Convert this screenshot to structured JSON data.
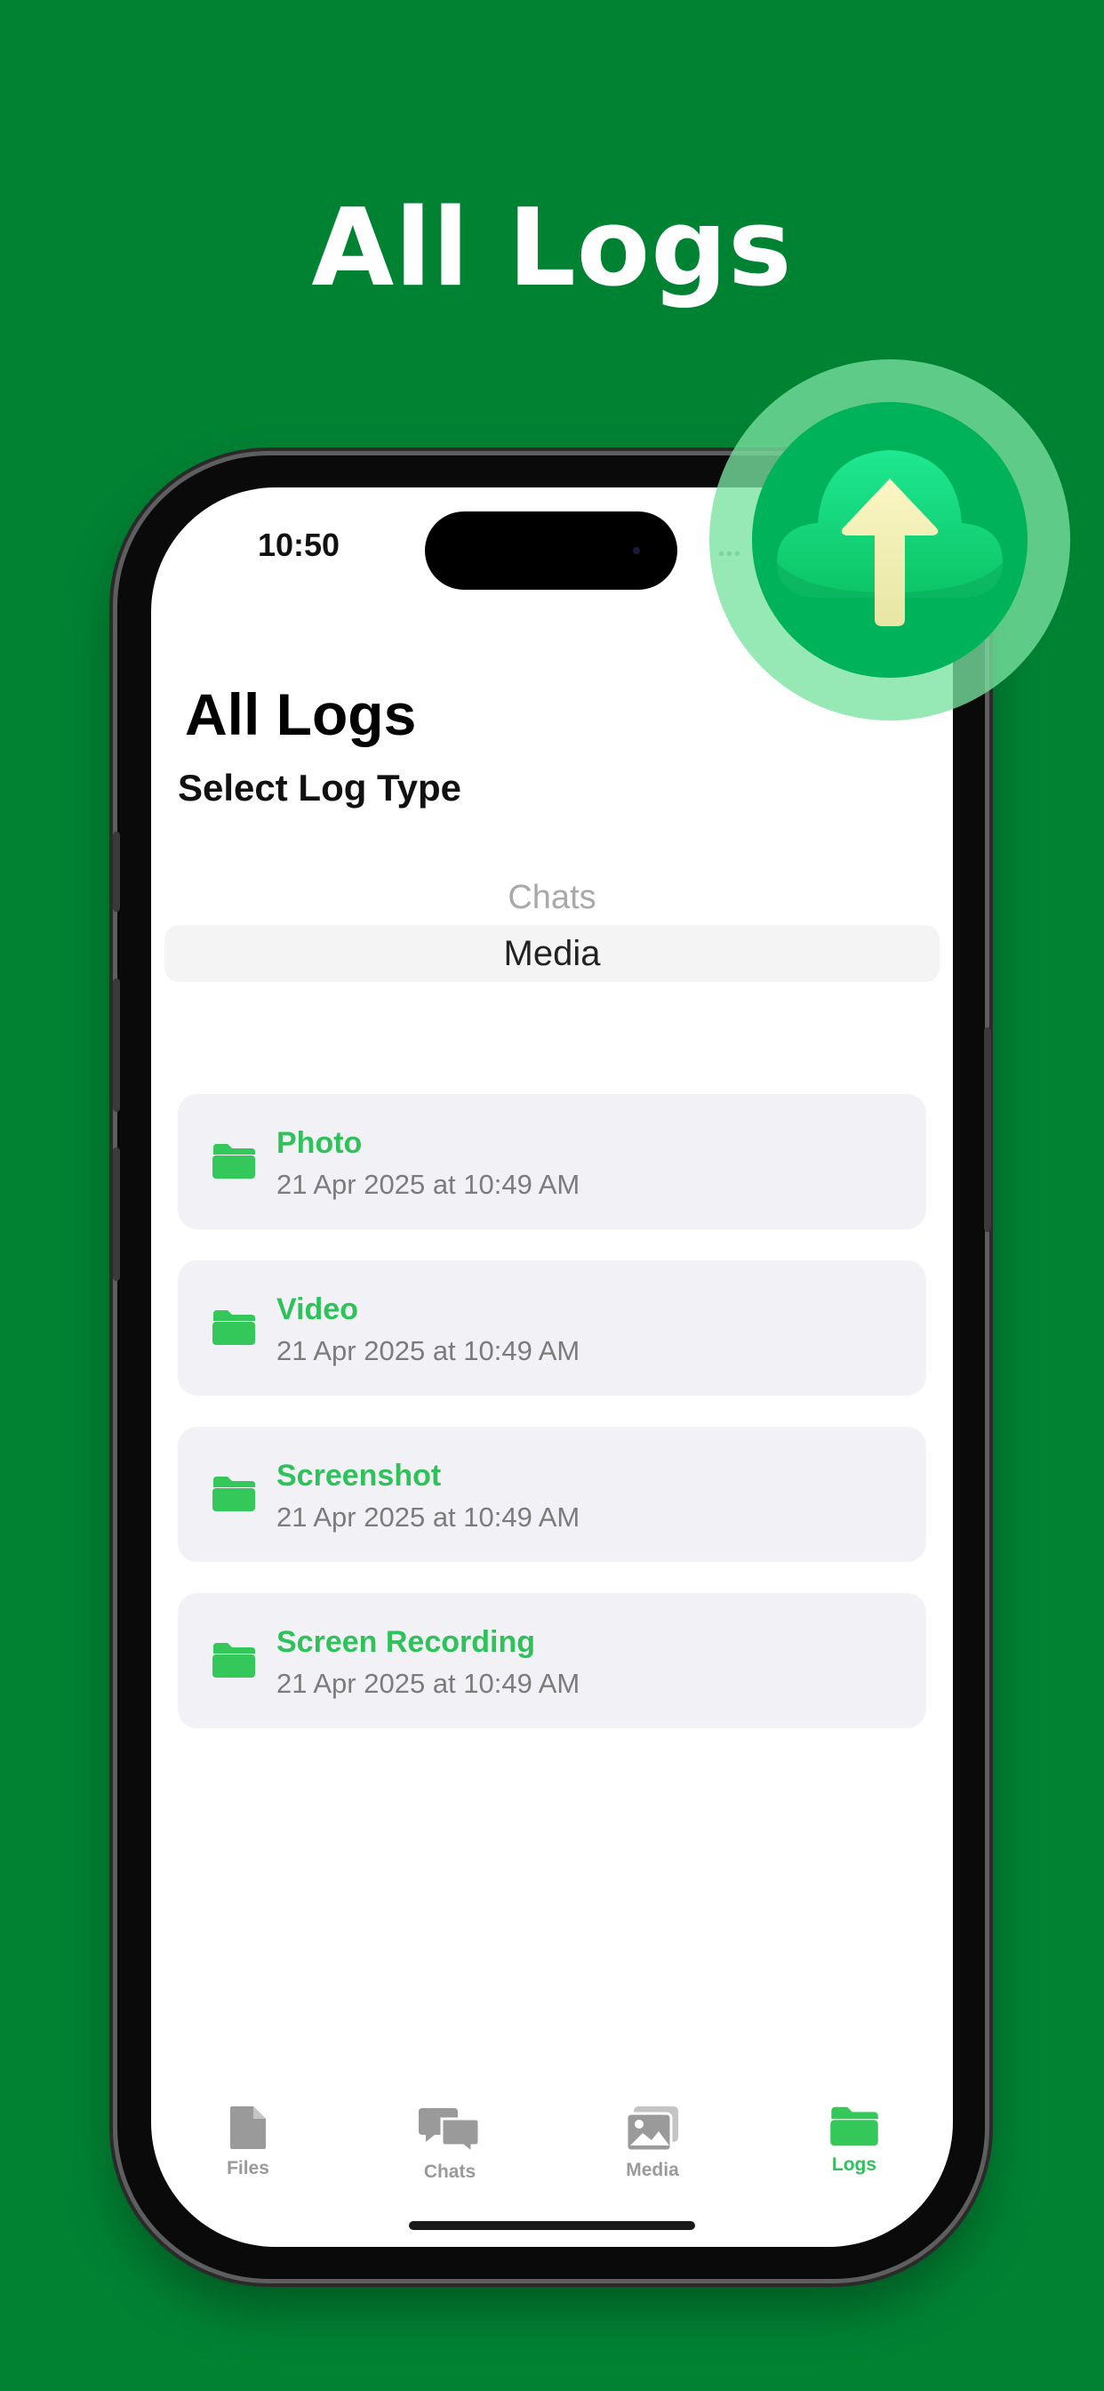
{
  "headline": "All Logs",
  "status_bar": {
    "time": "10:50",
    "dots": "•••"
  },
  "page": {
    "title": "All Logs",
    "section_title": "Select Log Type"
  },
  "picker": {
    "options_visible": [
      "Chats",
      "Media"
    ],
    "upper_option": "Chats",
    "selected": "Media"
  },
  "logs": [
    {
      "name": "Photo",
      "date": "21 Apr 2025 at 10:49 AM"
    },
    {
      "name": "Video",
      "date": "21 Apr 2025 at 10:49 AM"
    },
    {
      "name": "Screenshot",
      "date": "21 Apr 2025 at 10:49 AM"
    },
    {
      "name": "Screen Recording",
      "date": "21 Apr 2025 at 10:49 AM"
    }
  ],
  "tabs": [
    {
      "label": "Files",
      "icon": "file-icon",
      "active": false
    },
    {
      "label": "Chats",
      "icon": "chat-bubbles-icon",
      "active": false
    },
    {
      "label": "Media",
      "icon": "photos-icon",
      "active": false
    },
    {
      "label": "Logs",
      "icon": "folder-icon",
      "active": true
    }
  ],
  "colors": {
    "background": "#008233",
    "accent": "#2fc25a",
    "badge": "#00b35a"
  },
  "badge_icon": "cloud-upload-icon"
}
